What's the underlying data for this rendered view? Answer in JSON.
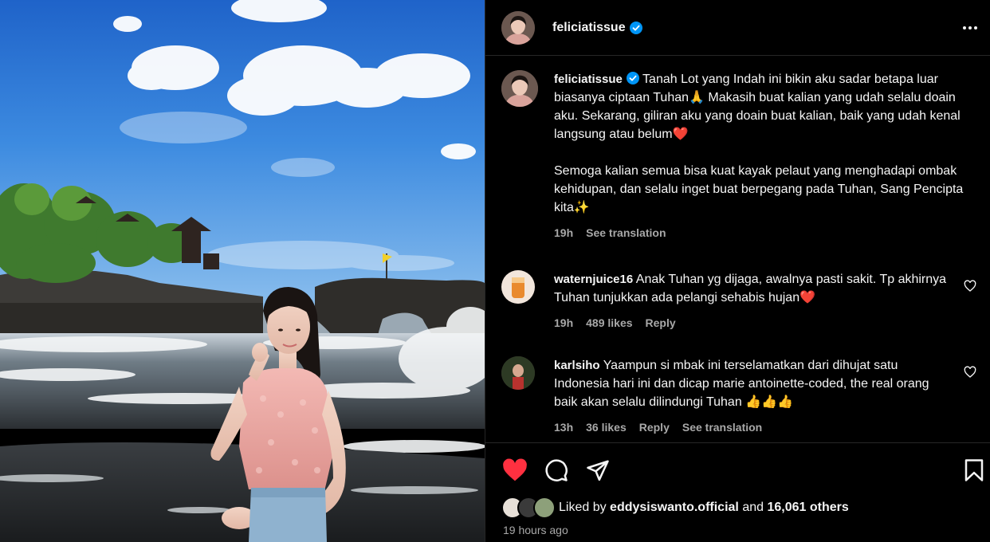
{
  "post": {
    "username": "feliciatissue",
    "verified": true,
    "more_icon": "more-horizontal-icon"
  },
  "caption": {
    "username": "feliciatissue",
    "paragraph1": "Tanah Lot yang Indah ini bikin aku sadar betapa luar biasanya ciptaan Tuhan🙏   Makasih buat kalian yang udah selalu doain aku. Sekarang, giliran aku yang doain buat kalian, baik yang udah kenal langsung atau belum❤️",
    "paragraph2": "Semoga kalian semua bisa kuat kayak pelaut yang menghadapi ombak kehidupan, dan selalu inget buat berpegang pada Tuhan, Sang Pencipta kita✨",
    "time": "19h",
    "see_translation": "See translation"
  },
  "comments": [
    {
      "username": "waternjuice16",
      "text": "Anak Tuhan yg dijaga, awalnya pasti sakit. Tp akhirnya Tuhan tunjukkan ada pelangi sehabis hujan❤️",
      "time": "19h",
      "likes": "489 likes",
      "reply": "Reply"
    },
    {
      "username": "karlsiho",
      "text": "Yaampun si mbak ini terselamatkan dari dihujat satu Indonesia hari ini dan dicap marie antoinette-coded, the real orang baik akan selalu dilindungi Tuhan 👍👍👍",
      "time": "13h",
      "likes": "36 likes",
      "reply": "Reply",
      "see_translation": "See translation"
    }
  ],
  "actions": {
    "like_state": "liked",
    "like_color": "#ff3040",
    "icons": [
      "heart-filled-icon",
      "comment-icon",
      "share-icon",
      "bookmark-icon"
    ]
  },
  "likes": {
    "prefix": "Liked by",
    "user": "eddysiswanto.official",
    "middle": "and",
    "count": "16,061 others"
  },
  "posted_ago": "19 hours ago",
  "colors": {
    "background": "#000000",
    "text": "#f5f5f5",
    "muted": "#a8a8a8",
    "verified": "#0095f6"
  }
}
